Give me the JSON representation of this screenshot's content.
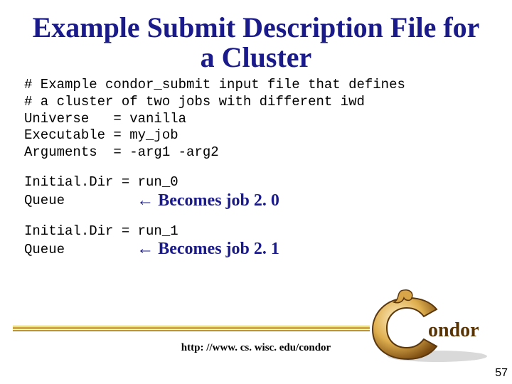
{
  "slide": {
    "title": "Example Submit Description File for a Cluster",
    "code_block": "# Example condor_submit input file that defines\n# a cluster of two jobs with different iwd\nUniverse   = vanilla\nExecutable = my_job\nArguments  = -arg1 -arg2",
    "section1": {
      "initialdir": "Initial.Dir = run_0",
      "queue_label": "Queue        ",
      "annotation": "← Becomes job 2. 0"
    },
    "section2": {
      "initialdir": "Initial.Dir = run_1",
      "queue_label": "Queue        ",
      "annotation": "← Becomes job 2. 1"
    },
    "footer_url": "http: //www. cs. wisc. edu/condor",
    "page_number": "57",
    "logo_text": "ondor",
    "logo_name": "Condor"
  }
}
